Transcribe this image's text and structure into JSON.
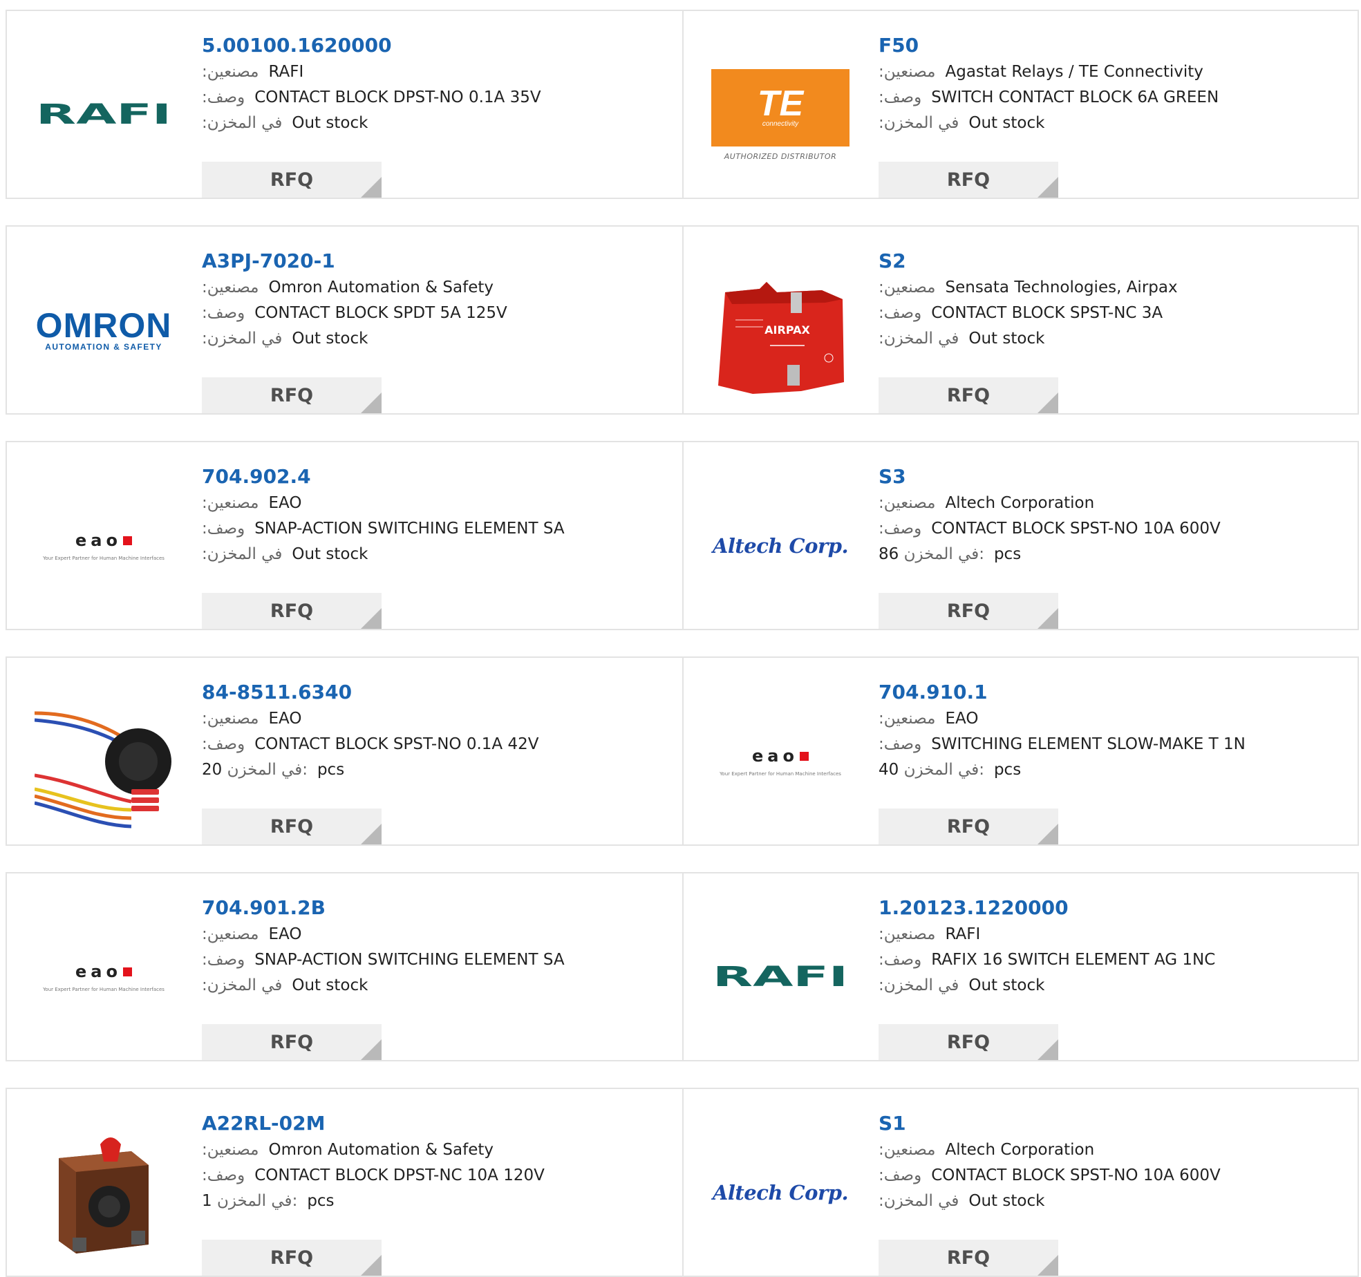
{
  "labels": {
    "manufacturer": ":مصنعين",
    "description": ":وصف",
    "stock": ":في المخزن",
    "stock_count": "في المخزن:",
    "pcs": "pcs"
  },
  "rows": [
    {
      "cards": [
        {
          "part": "5.00100.1620000",
          "logo": "RAFI",
          "manufacturer": "RAFI",
          "description": "CONTACT BLOCK DPST-NO 0.1A 35V",
          "stock": "Out stock",
          "rfq": "RFQ"
        },
        {
          "part": "F50",
          "logo_main": "TE",
          "logo_sub": "connectivity",
          "logo_caption": "AUTHORIZED DISTRIBUTOR",
          "manufacturer": "Agastat Relays / TE Connectivity",
          "description": "SWITCH CONTACT BLOCK 6A GREEN",
          "stock": "Out stock",
          "rfq": "RFQ"
        }
      ]
    },
    {
      "cards": [
        {
          "part": "A3PJ-7020-1",
          "logo_main": "OMRON",
          "logo_sub": "AUTOMATION & SAFETY",
          "manufacturer": "Omron Automation & Safety",
          "description": "CONTACT BLOCK SPDT 5A 125V",
          "stock": "Out stock",
          "rfq": "RFQ"
        },
        {
          "part": "S2",
          "image_text": "AIRPAX",
          "manufacturer": "Sensata Technologies, Airpax",
          "description": "CONTACT BLOCK SPST-NC 3A",
          "stock": "Out stock",
          "rfq": "RFQ"
        }
      ]
    },
    {
      "cards": [
        {
          "part": "704.902.4",
          "logo_main": "eao",
          "logo_sub": "Your Expert Partner for Human Machine Interfaces",
          "manufacturer": "EAO",
          "description": "SNAP-ACTION SWITCHING ELEMENT SA",
          "stock": "Out stock",
          "rfq": "RFQ"
        },
        {
          "part": "S3",
          "logo_main": "Altech Corp.",
          "manufacturer": "Altech Corporation",
          "description": "CONTACT BLOCK SPST-NO 10A 600V",
          "stock_qty": "86",
          "rfq": "RFQ"
        }
      ]
    },
    {
      "cards": [
        {
          "part": "84-8511.6340",
          "manufacturer": "EAO",
          "description": "CONTACT BLOCK SPST-NO 0.1A 42V",
          "stock_qty": "20",
          "rfq": "RFQ"
        },
        {
          "part": "704.910.1",
          "logo_main": "eao",
          "logo_sub": "Your Expert Partner for Human Machine Interfaces",
          "manufacturer": "EAO",
          "description": "SWITCHING ELEMENT SLOW-MAKE T 1N",
          "stock_qty": "40",
          "rfq": "RFQ"
        }
      ]
    },
    {
      "cards": [
        {
          "part": "704.901.2B",
          "logo_main": "eao",
          "logo_sub": "Your Expert Partner for Human Machine Interfaces",
          "manufacturer": "EAO",
          "description": "SNAP-ACTION SWITCHING ELEMENT SA",
          "stock": "Out stock",
          "rfq": "RFQ"
        },
        {
          "part": "1.20123.1220000",
          "logo": "RAFI",
          "manufacturer": "RAFI",
          "description": "RAFIX 16 SWITCH ELEMENT AG 1NC",
          "stock": "Out stock",
          "rfq": "RFQ"
        }
      ]
    },
    {
      "cards": [
        {
          "part": "A22RL-02M",
          "manufacturer": "Omron Automation & Safety",
          "description": "CONTACT BLOCK DPST-NC 10A 120V",
          "stock_qty": "1",
          "rfq": "RFQ"
        },
        {
          "part": "S1",
          "logo_main": "Altech Corp.",
          "manufacturer": "Altech Corporation",
          "description": "CONTACT BLOCK SPST-NO 10A 600V",
          "stock": "Out stock",
          "rfq": "RFQ"
        }
      ]
    }
  ]
}
